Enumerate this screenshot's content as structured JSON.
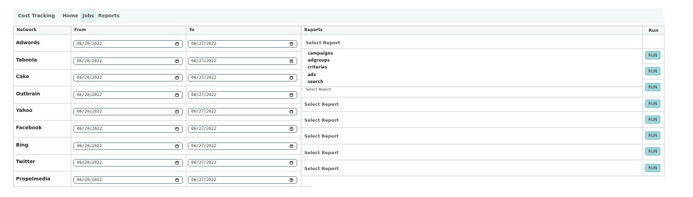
{
  "nav": {
    "brand": "Cost Tracking",
    "items": [
      "Home",
      "Jobs",
      "Reports"
    ]
  },
  "table": {
    "headers": {
      "network": "Network",
      "from": "From",
      "to": "To",
      "reports": "Reports",
      "run": "Run"
    },
    "rows": [
      {
        "network": "Adwords",
        "from": "06/20/2022",
        "to": "06/27/2022"
      },
      {
        "network": "Taboola",
        "from": "06/20/2022",
        "to": "06/27/2022"
      },
      {
        "network": "Cake",
        "from": "06/20/2022",
        "to": "06/27/2022"
      },
      {
        "network": "Outbrain",
        "from": "06/20/2022",
        "to": "06/27/2022"
      },
      {
        "network": "Yahoo",
        "from": "06/20/2022",
        "to": "06/27/2022"
      },
      {
        "network": "Facebook",
        "from": "06/20/2022",
        "to": "06/27/2022"
      },
      {
        "network": "Bing",
        "from": "06/20/2022",
        "to": "06/27/2022"
      },
      {
        "network": "Twitter",
        "from": "06/20/2022",
        "to": "06/27/2022"
      },
      {
        "network": "Propelmedia",
        "from": "06/20/2022",
        "to": "06/27/2022"
      }
    ],
    "reports": [
      "Select Report",
      "Select Report",
      "Select Report",
      "Select Report",
      "Select Report",
      "Select Report",
      "Select Report"
    ],
    "report_options": [
      "campaigns",
      "adgroups",
      "criterias",
      "ads",
      "search"
    ],
    "run_label": "RUN"
  },
  "icons": {
    "date_picker": "calendar-icon"
  },
  "colors": {
    "nav_bg": "#f3f8f9",
    "run_button": "#9fd9db",
    "border": "#d7dbdc"
  }
}
